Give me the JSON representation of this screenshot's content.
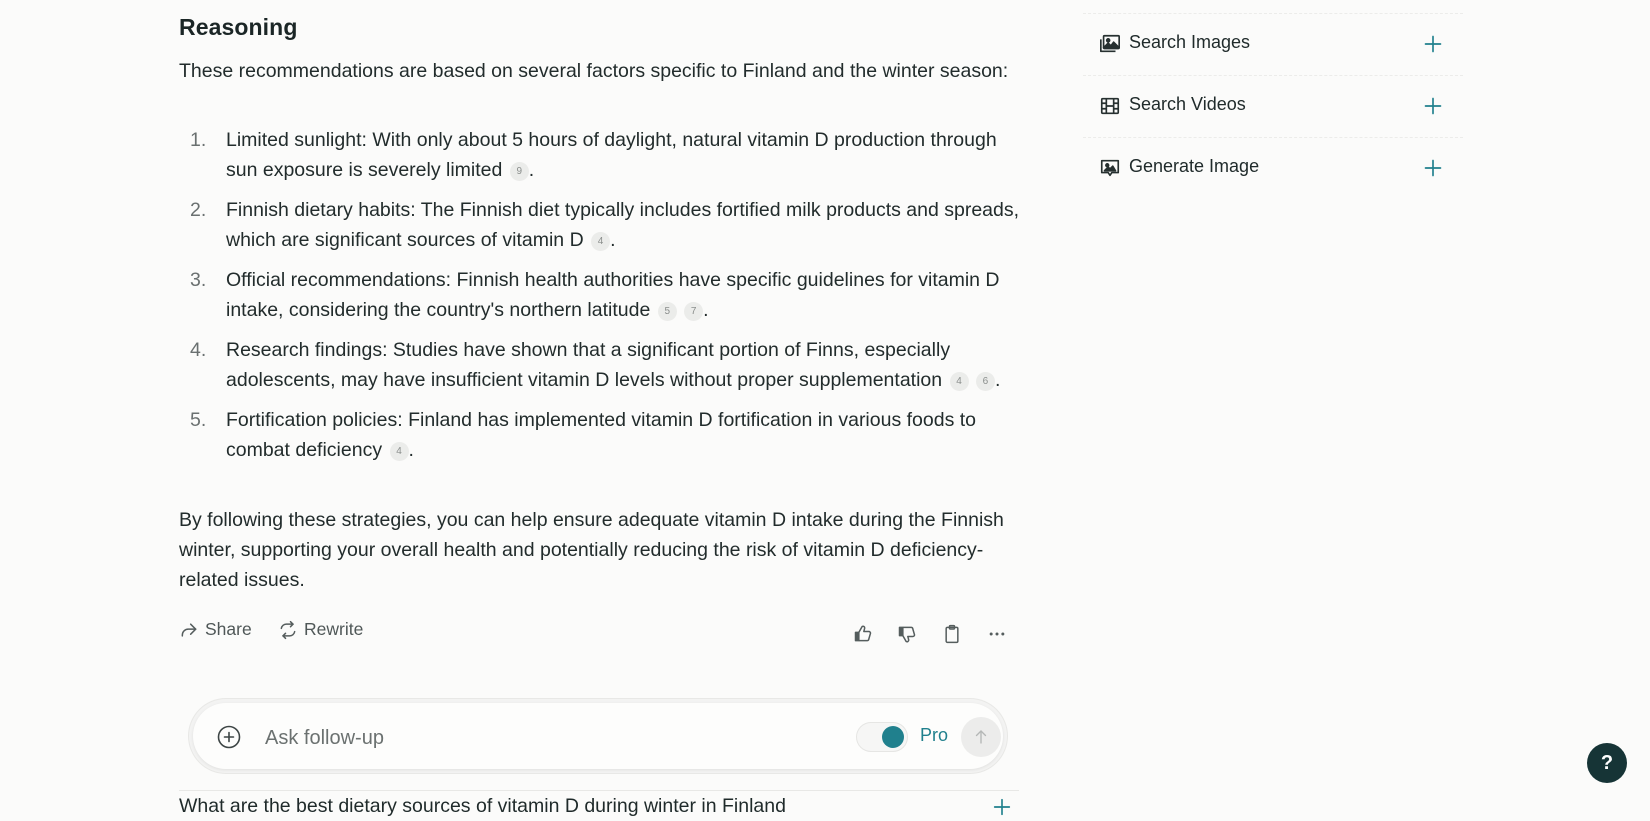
{
  "answer": {
    "heading": "Reasoning",
    "intro": "These recommendations are based on several factors specific to Finland and the winter season:",
    "items": [
      {
        "num": "1.",
        "text": "Limited sunlight: With only about 5 hours of daylight, natural vitamin D production through sun exposure is severely limited",
        "citations": [
          "9"
        ]
      },
      {
        "num": "2.",
        "text": "Finnish dietary habits: The Finnish diet typically includes fortified milk products and spreads, which are significant sources of vitamin D",
        "citations": [
          "4"
        ]
      },
      {
        "num": "3.",
        "text": "Official recommendations: Finnish health authorities have specific guidelines for vitamin D intake, considering the country's northern latitude",
        "citations": [
          "5",
          "7"
        ]
      },
      {
        "num": "4.",
        "text": "Research findings: Studies have shown that a significant portion of Finns, especially adolescents, may have insufficient vitamin D levels without proper supplementation",
        "citations": [
          "4",
          "6"
        ]
      },
      {
        "num": "5.",
        "text": "Fortification policies: Finland has implemented vitamin D fortification in various foods to combat deficiency",
        "citations": [
          "4"
        ]
      }
    ],
    "closing": "By following these strategies, you can help ensure adequate vitamin D intake during the Finnish winter, supporting your overall health and potentially reducing the risk of vitamin D deficiency-related issues."
  },
  "actions": {
    "share_label": "Share",
    "rewrite_label": "Rewrite",
    "icons": [
      "thumbs-up-icon",
      "thumbs-down-icon",
      "clipboard-icon",
      "more-icon"
    ]
  },
  "followup": {
    "placeholder": "Ask follow-up",
    "value": "",
    "pro_label": "Pro",
    "pro_enabled": true
  },
  "related": {
    "question": "What are the best dietary sources of vitamin D during winter in Finland"
  },
  "sidebar": {
    "items": [
      {
        "label": "Search Images",
        "icon": "images-icon"
      },
      {
        "label": "Search Videos",
        "icon": "film-icon"
      },
      {
        "label": "Generate Image",
        "icon": "generate-image-icon"
      }
    ]
  },
  "help": {
    "label": "?"
  },
  "colors": {
    "accent": "#20808d",
    "help_bg": "#163436",
    "text": "#222c2c"
  }
}
